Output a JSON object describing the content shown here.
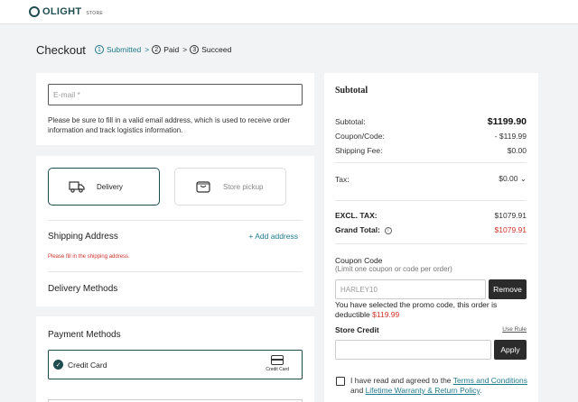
{
  "brand": {
    "name": "OLIGHT",
    "store_label": "STORE"
  },
  "page": {
    "title": "Checkout"
  },
  "steps": [
    {
      "num": "1",
      "label": "Submitted",
      "active": true,
      "separator": ">"
    },
    {
      "num": "2",
      "label": "Paid",
      "active": false,
      "separator": ">"
    },
    {
      "num": "3",
      "label": "Succeed",
      "active": false,
      "separator": ""
    }
  ],
  "email": {
    "placeholder": "E-mail *",
    "value": "",
    "help": "Please be sure to fill in a valid email address, which is used to receive order information and track logistics information."
  },
  "shipping": {
    "options": [
      {
        "label": "Delivery",
        "icon": "truck-icon",
        "selected": true
      },
      {
        "label": "Store pickup",
        "icon": "shopping-bag-icon",
        "selected": false
      }
    ],
    "address_title": "Shipping Address",
    "add_address": "+ Add address",
    "error": "Please fill in the shipping address.",
    "delivery_methods_title": "Delivery Methods"
  },
  "payment": {
    "title": "Payment Methods",
    "selected_method": "Credit Card",
    "card_icon_label": "Credit Card"
  },
  "summary": {
    "title": "Subtotal",
    "subtotal_label": "Subtotal:",
    "subtotal_value": "$1199.90",
    "coupon_label": "Coupon/Code:",
    "coupon_value": "- $119.99",
    "shipping_label": "Shipping Fee:",
    "shipping_value": "$0.00",
    "tax_label": "Tax:",
    "tax_value": "$0.00",
    "excl_tax_label": "EXCL. TAX:",
    "excl_tax_value": "$1079.91",
    "grand_total_label": "Grand Total:",
    "grand_total_value": "$1079.91"
  },
  "coupon": {
    "title": "Coupon Code",
    "subtitle": "(Limit one coupon or code per order)",
    "value": "HARLEY10",
    "remove_label": "Remove",
    "message_prefix": "You have selected the promo code, this order is deductible",
    "message_amount": "$119.99"
  },
  "store_credit": {
    "title": "Store Credit",
    "use_rule": "Use Rule",
    "value": "",
    "apply_label": "Apply"
  },
  "agreement": {
    "prefix": "I have read and agreed to the",
    "terms_link": "Terms and Conditions",
    "middle": "and",
    "warranty_link": "Lifetime Warranty & Return Policy",
    "suffix": "."
  },
  "colors": {
    "brand": "#1f4d4f",
    "accent": "#1f7a8c",
    "error": "#d0342c",
    "button_dark": "#2b2b2b",
    "background": "#f2f3f4"
  }
}
